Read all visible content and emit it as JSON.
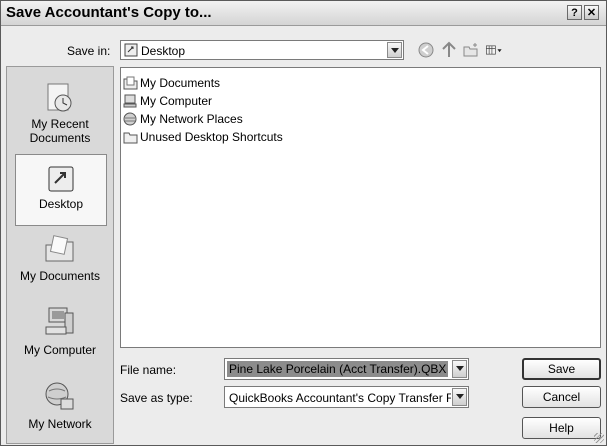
{
  "window": {
    "title": "Save Accountant's Copy to...",
    "help_glyph": "?",
    "close_glyph": "✕"
  },
  "toolbar": {
    "save_in_label": "Save in:",
    "save_in_value": "Desktop",
    "icons": [
      "back-icon",
      "up-folder-icon",
      "new-folder-icon",
      "views-menu-icon"
    ]
  },
  "places": [
    {
      "label_line1": "My Recent",
      "label_line2": "Documents",
      "icon": "recent-documents-icon"
    },
    {
      "label_line1": "Desktop",
      "label_line2": "",
      "icon": "desktop-icon"
    },
    {
      "label_line1": "My Documents",
      "label_line2": "",
      "icon": "my-documents-icon"
    },
    {
      "label_line1": "My Computer",
      "label_line2": "",
      "icon": "my-computer-icon"
    },
    {
      "label_line1": "My Network",
      "label_line2": "",
      "icon": "my-network-icon"
    }
  ],
  "files": [
    {
      "name": "My Documents",
      "icon": "documents-folder-icon"
    },
    {
      "name": "My Computer",
      "icon": "computer-icon"
    },
    {
      "name": "My Network Places",
      "icon": "network-places-icon"
    },
    {
      "name": "Unused Desktop Shortcuts",
      "icon": "folder-icon"
    }
  ],
  "form": {
    "file_name_label": "File name:",
    "file_name_value": "Pine Lake Porcelain (Acct Transfer).QBX",
    "save_as_type_label": "Save as type:",
    "save_as_type_value": "QuickBooks Accountant's Copy Transfer Files ("
  },
  "buttons": {
    "save": "Save",
    "cancel": "Cancel",
    "help": "Help"
  },
  "colors": {
    "selection_highlight": "#8c8c8c",
    "dialog_bg": "#ececec"
  }
}
